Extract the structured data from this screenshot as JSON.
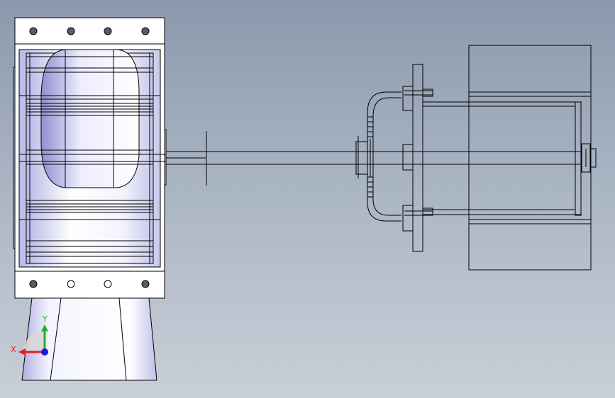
{
  "viewport": {
    "background_top": "#8a99ad",
    "background_bottom": "#c9cfd8",
    "line_color": "#000000",
    "face_tint": "#c8c8ea",
    "face_light": "#ffffff"
  },
  "model": {
    "view": "front",
    "display_style": "shaded-with-edges",
    "parts": [
      "valve-housing",
      "transition-hopper",
      "drive-shaft",
      "coupling",
      "motor-bracket",
      "gear-motor"
    ]
  },
  "triad": {
    "x_label": "X",
    "y_label": "Y",
    "x_color": "#e02020",
    "y_color": "#1fb51f",
    "z_color": "#1a1ad0"
  }
}
